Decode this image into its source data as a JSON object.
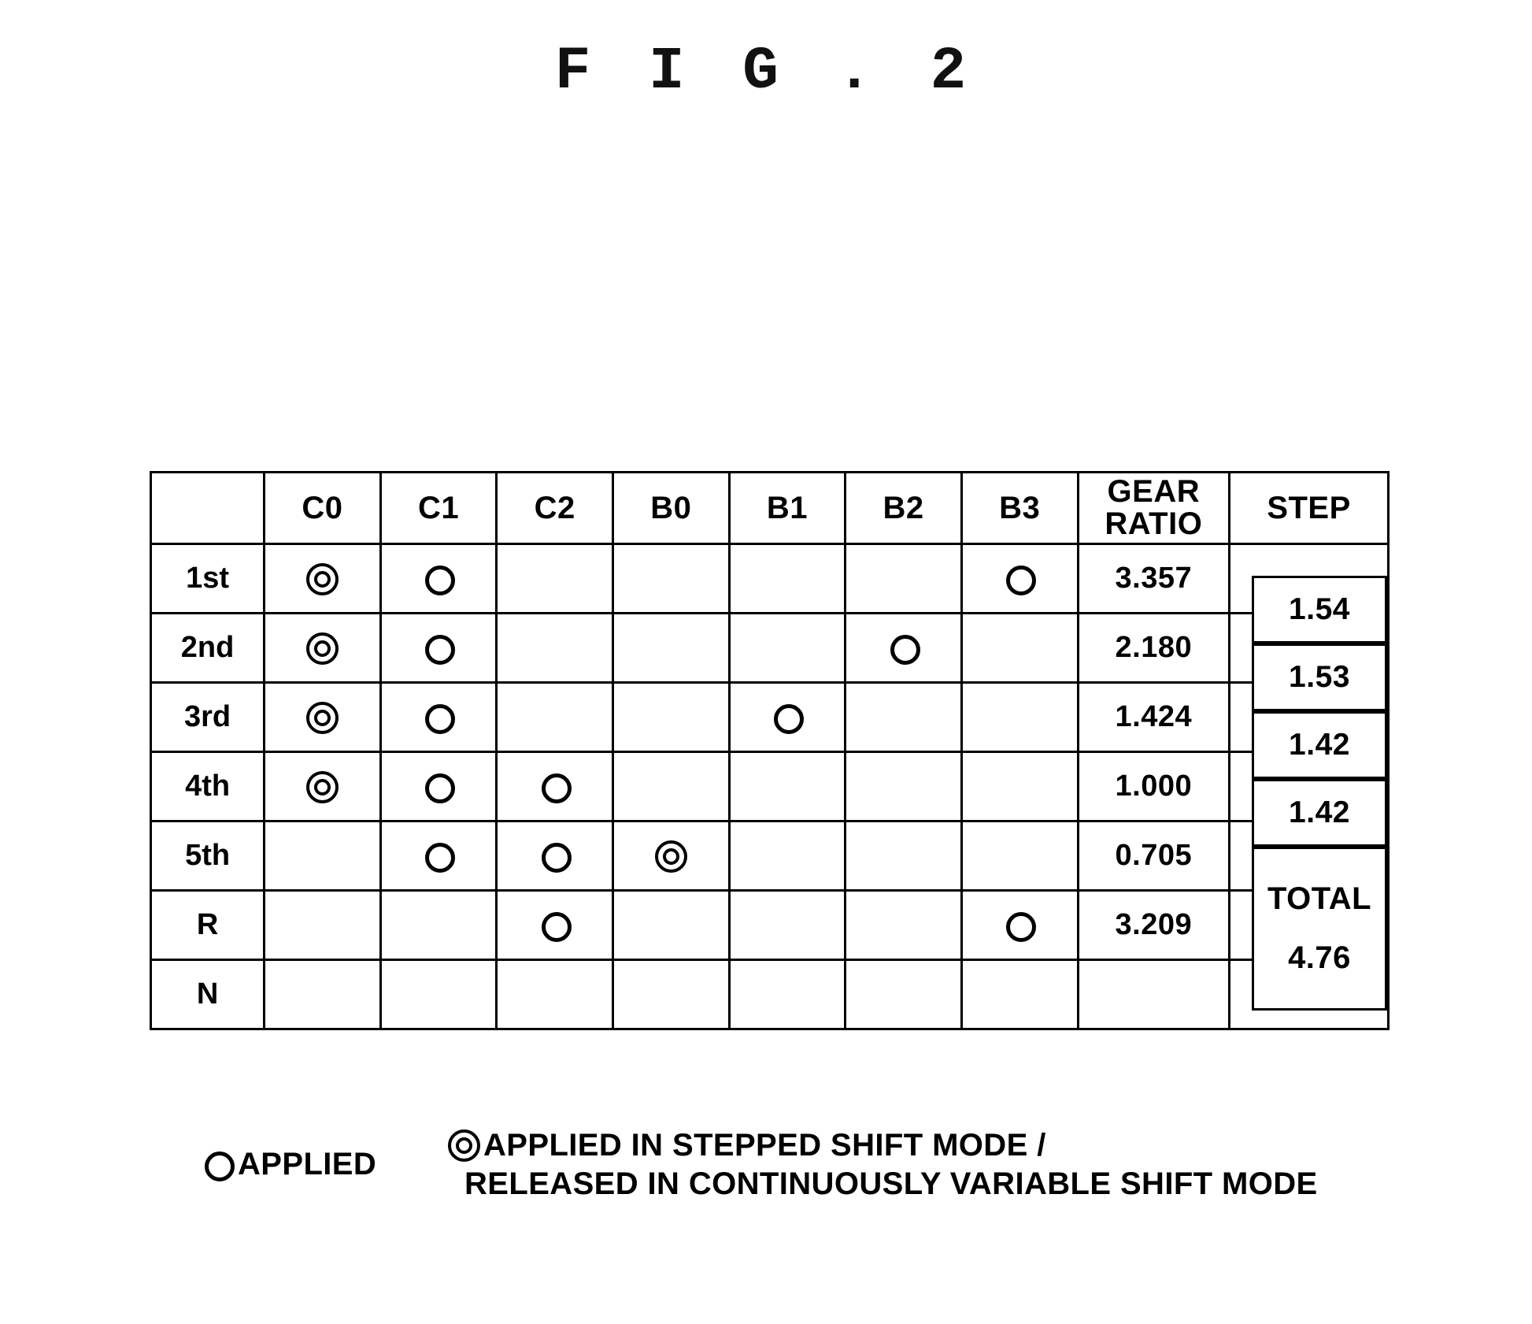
{
  "figure": {
    "title": "F I G . 2"
  },
  "table": {
    "columns": [
      "",
      "C0",
      "C1",
      "C2",
      "B0",
      "B1",
      "B2",
      "B3",
      "GEAR RATIO",
      "STEP"
    ],
    "header": {
      "blank": "",
      "c0": "C0",
      "c1": "C1",
      "c2": "C2",
      "b0": "B0",
      "b1": "B1",
      "b2": "B2",
      "b3": "B3",
      "gear_ratio_line1": "GEAR",
      "gear_ratio_line2": "RATIO",
      "step": "STEP"
    },
    "rows": [
      {
        "label": "1st",
        "C0": "double",
        "C1": "single",
        "C2": "",
        "B0": "",
        "B1": "",
        "B2": "",
        "B3": "single",
        "gear_ratio": "3.357"
      },
      {
        "label": "2nd",
        "C0": "double",
        "C1": "single",
        "C2": "",
        "B0": "",
        "B1": "",
        "B2": "single",
        "B3": "",
        "gear_ratio": "2.180"
      },
      {
        "label": "3rd",
        "C0": "double",
        "C1": "single",
        "C2": "",
        "B0": "",
        "B1": "single",
        "B2": "",
        "B3": "",
        "gear_ratio": "1.424"
      },
      {
        "label": "4th",
        "C0": "double",
        "C1": "single",
        "C2": "single",
        "B0": "",
        "B1": "",
        "B2": "",
        "B3": "",
        "gear_ratio": "1.000"
      },
      {
        "label": "5th",
        "C0": "",
        "C1": "single",
        "C2": "single",
        "B0": "double",
        "B1": "",
        "B2": "",
        "B3": "",
        "gear_ratio": "0.705"
      },
      {
        "label": "R",
        "C0": "",
        "C1": "",
        "C2": "single",
        "B0": "",
        "B1": "",
        "B2": "",
        "B3": "single",
        "gear_ratio": "3.209"
      },
      {
        "label": "N",
        "C0": "",
        "C1": "",
        "C2": "",
        "B0": "",
        "B1": "",
        "B2": "",
        "B3": "",
        "gear_ratio": ""
      }
    ],
    "step_values": [
      "1.54",
      "1.53",
      "1.42",
      "1.42"
    ],
    "total_label": "TOTAL",
    "total_value": "4.76"
  },
  "legend": {
    "applied": "APPLIED",
    "stepped_line1": "APPLIED IN STEPPED SHIFT MODE /",
    "stepped_line2": "RELEASED IN CONTINUOUSLY VARIABLE SHIFT MODE"
  },
  "chart_data": {
    "type": "table",
    "title": "F I G . 2",
    "columns": [
      "",
      "C0",
      "C1",
      "C2",
      "B0",
      "B1",
      "B2",
      "B3",
      "GEAR RATIO",
      "STEP"
    ],
    "rows": [
      [
        "1st",
        "◎",
        "○",
        "",
        "",
        "",
        "",
        "○",
        "3.357",
        ""
      ],
      [
        "2nd",
        "◎",
        "○",
        "",
        "",
        "",
        "○",
        "",
        "2.180",
        "1.54"
      ],
      [
        "3rd",
        "◎",
        "○",
        "",
        "",
        "○",
        "",
        "",
        "1.424",
        "1.53"
      ],
      [
        "4th",
        "◎",
        "○",
        "○",
        "",
        "",
        "",
        "",
        "1.000",
        "1.42"
      ],
      [
        "5th",
        "",
        "○",
        "○",
        "◎",
        "",
        "",
        "",
        "0.705",
        "1.42"
      ],
      [
        "R",
        "",
        "",
        "○",
        "",
        "",
        "",
        "○",
        "3.209",
        "TOTAL 4.76"
      ],
      [
        "N",
        "",
        "",
        "",
        "",
        "",
        "",
        "",
        "",
        ""
      ]
    ],
    "gear_ratios": [
      3.357,
      2.18,
      1.424,
      1.0,
      0.705,
      3.209
    ],
    "steps": [
      1.54,
      1.53,
      1.42,
      1.42
    ],
    "total_step": 4.76,
    "legend": [
      "○ APPLIED",
      "◎ APPLIED IN STEPPED SHIFT MODE / RELEASED IN CONTINUOUSLY VARIABLE SHIFT MODE"
    ]
  }
}
